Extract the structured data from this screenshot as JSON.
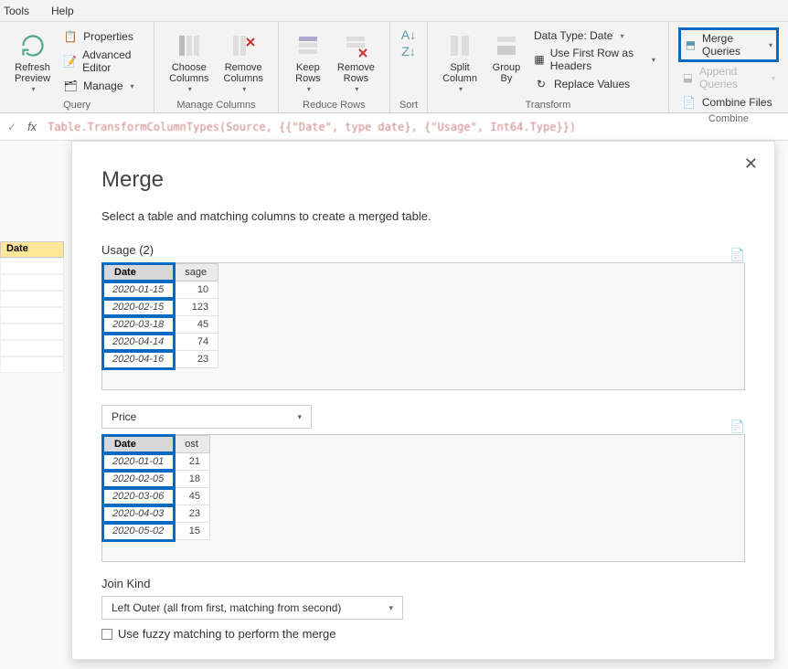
{
  "menubar": {
    "tools": "Tools",
    "help": "Help"
  },
  "ribbon": {
    "query": {
      "refresh": "Refresh\nPreview",
      "properties": "Properties",
      "advEditor": "Advanced Editor",
      "manage": "Manage",
      "label": "Query"
    },
    "manageCols": {
      "choose": "Choose\nColumns",
      "remove": "Remove\nColumns",
      "label": "Manage Columns"
    },
    "reduceRows": {
      "keep": "Keep\nRows",
      "remove": "Remove\nRows",
      "label": "Reduce Rows"
    },
    "sort": {
      "label": "Sort"
    },
    "transform": {
      "split": "Split\nColumn",
      "group": "Group\nBy",
      "dataType": "Data Type: Date",
      "firstRow": "Use First Row as Headers",
      "replace": "Replace Values",
      "label": "Transform"
    },
    "combine": {
      "merge": "Merge Queries",
      "append": "Append Queries",
      "combineFiles": "Combine Files",
      "label": "Combine"
    }
  },
  "formula": {
    "text": "Table.TransformColumnTypes(Source, {{\"Date\", type date}, {\"Usage\", Int64.Type}})"
  },
  "sidebar": {
    "dateHeader": "Date"
  },
  "dialog": {
    "title": "Merge",
    "desc": "Select a table and matching columns to create a merged table.",
    "table1Label": "Usage (2)",
    "table1": {
      "headers": [
        "Date",
        "sage"
      ],
      "rows": [
        [
          "2020-01-15",
          "10"
        ],
        [
          "2020-02-15",
          "123"
        ],
        [
          "2020-03-18",
          "45"
        ],
        [
          "2020-04-14",
          "74"
        ],
        [
          "2020-04-16",
          "23"
        ]
      ]
    },
    "table2Select": "Price",
    "table2": {
      "headers": [
        "Date",
        "ost"
      ],
      "rows": [
        [
          "2020-01-01",
          "21"
        ],
        [
          "2020-02-05",
          "18"
        ],
        [
          "2020-03-06",
          "45"
        ],
        [
          "2020-04-03",
          "23"
        ],
        [
          "2020-05-02",
          "15"
        ]
      ]
    },
    "joinKindLabel": "Join Kind",
    "joinKind": "Left Outer (all from first, matching from second)",
    "fuzzy": "Use fuzzy matching to perform the merge"
  }
}
